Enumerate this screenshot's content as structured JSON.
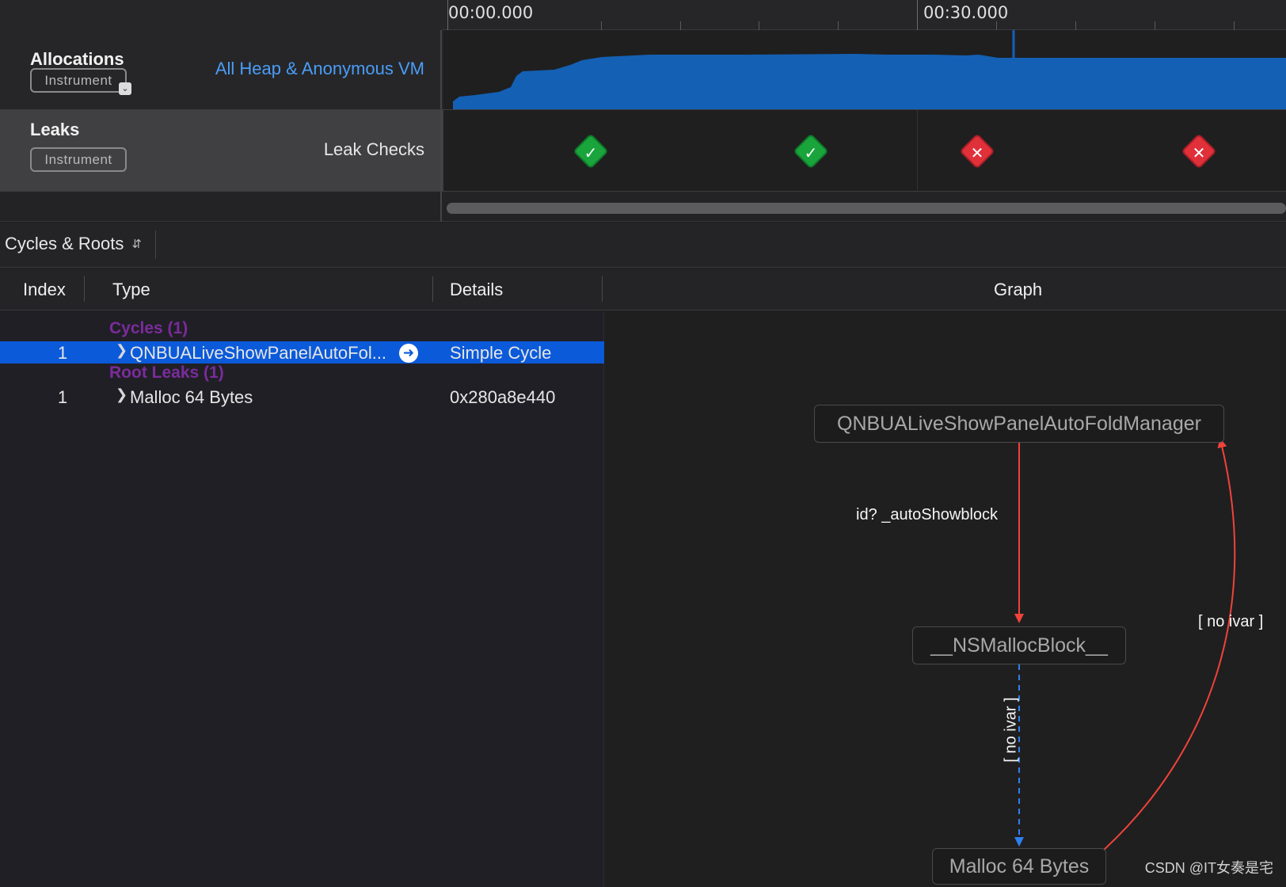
{
  "ruler": {
    "labels": [
      "00:00.000",
      "00:30.000"
    ]
  },
  "tracks": {
    "allocations": {
      "name": "Allocations",
      "badge": "Instrument",
      "subtitle": "All Heap & Anonymous VM",
      "subtitle_color": "#4a9df8",
      "graph_color": "#1460b4"
    },
    "leaks": {
      "name": "Leaks",
      "badge": "Instrument",
      "subtitle": "Leak Checks",
      "checks": [
        {
          "status": "ok",
          "icon": "checkmark-icon"
        },
        {
          "status": "ok",
          "icon": "checkmark-icon"
        },
        {
          "status": "leak",
          "icon": "x-mark-icon"
        },
        {
          "status": "leak",
          "icon": "x-mark-icon"
        }
      ]
    }
  },
  "detail": {
    "view_selector": "Cycles & Roots",
    "columns": {
      "index": "Index",
      "type": "Type",
      "details": "Details",
      "graph": "Graph"
    },
    "groups": [
      {
        "header": "Cycles (1)",
        "rows": [
          {
            "index": "1",
            "type": "QNBUALiveShowPanelAutoFol...",
            "details": "Simple Cycle",
            "selected": true
          }
        ]
      },
      {
        "header": "Root Leaks (1)",
        "rows": [
          {
            "index": "1",
            "type": "Malloc 64 Bytes",
            "details": "0x280a8e440",
            "selected": false
          }
        ]
      }
    ]
  },
  "graph": {
    "nodes": {
      "manager": "QNBUALiveShowPanelAutoFoldManager",
      "block": "__NSMallocBlock__",
      "malloc": "Malloc 64 Bytes"
    },
    "edges": {
      "manager_to_block": "id? _autoShowblock",
      "block_to_malloc": "[ no ivar ]",
      "malloc_to_manager": "[ no ivar ]"
    },
    "colors": {
      "strong_edge": "#f0433a",
      "weak_edge": "#2f7ff0"
    }
  },
  "watermark": "CSDN @IT女奏是宅"
}
